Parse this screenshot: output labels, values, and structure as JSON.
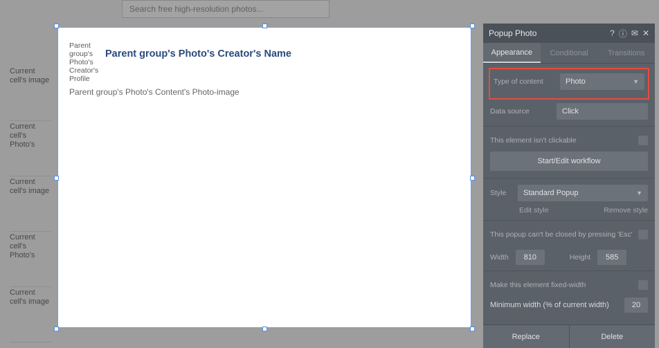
{
  "search": {
    "placeholder": "Search free high-resolution photos..."
  },
  "bg_cells": {
    "c1": "Current cell's image",
    "c2": "Current cell's Photo's",
    "c3": "Current cell's image",
    "c4": "Current cell's Photo's",
    "c5": "Current cell's image"
  },
  "popup": {
    "avatar_label": "Parent group's Photo's Creator's Profile",
    "creator_name": "Parent group's Photo's Creator's Name",
    "content_line": "Parent group's Photo's Content's Photo-image"
  },
  "panel": {
    "title": "Popup Photo",
    "tabs": {
      "appearance": "Appearance",
      "conditional": "Conditional",
      "transitions": "Transitions"
    },
    "type_of_content_label": "Type of content",
    "type_of_content_value": "Photo",
    "data_source_label": "Data source",
    "data_source_value": "Click",
    "not_clickable": "This element isn't clickable",
    "start_workflow": "Start/Edit workflow",
    "style_label": "Style",
    "style_value": "Standard Popup",
    "edit_style": "Edit style",
    "remove_style": "Remove style",
    "esc_label": "This popup can't be closed by pressing 'Esc'",
    "width_label": "Width",
    "width_value": "810",
    "height_label": "Height",
    "height_value": "585",
    "fixed_width_label": "Make this element fixed-width",
    "min_width_label": "Minimum width (% of current width)",
    "min_width_value": "20",
    "replace": "Replace",
    "delete": "Delete"
  }
}
